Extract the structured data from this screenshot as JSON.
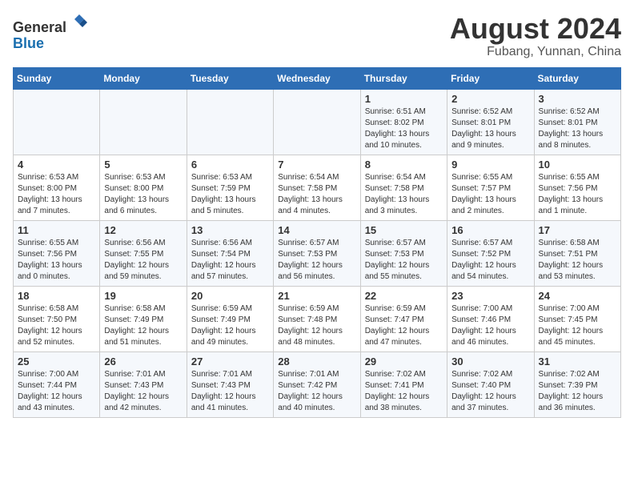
{
  "header": {
    "logo_general": "General",
    "logo_blue": "Blue",
    "month_title": "August 2024",
    "location": "Fubang, Yunnan, China"
  },
  "weekdays": [
    "Sunday",
    "Monday",
    "Tuesday",
    "Wednesday",
    "Thursday",
    "Friday",
    "Saturday"
  ],
  "weeks": [
    [
      {
        "day": "",
        "sunrise": "",
        "sunset": "",
        "daylight": ""
      },
      {
        "day": "",
        "sunrise": "",
        "sunset": "",
        "daylight": ""
      },
      {
        "day": "",
        "sunrise": "",
        "sunset": "",
        "daylight": ""
      },
      {
        "day": "",
        "sunrise": "",
        "sunset": "",
        "daylight": ""
      },
      {
        "day": "1",
        "sunrise": "Sunrise: 6:51 AM",
        "sunset": "Sunset: 8:02 PM",
        "daylight": "Daylight: 13 hours and 10 minutes."
      },
      {
        "day": "2",
        "sunrise": "Sunrise: 6:52 AM",
        "sunset": "Sunset: 8:01 PM",
        "daylight": "Daylight: 13 hours and 9 minutes."
      },
      {
        "day": "3",
        "sunrise": "Sunrise: 6:52 AM",
        "sunset": "Sunset: 8:01 PM",
        "daylight": "Daylight: 13 hours and 8 minutes."
      }
    ],
    [
      {
        "day": "4",
        "sunrise": "Sunrise: 6:53 AM",
        "sunset": "Sunset: 8:00 PM",
        "daylight": "Daylight: 13 hours and 7 minutes."
      },
      {
        "day": "5",
        "sunrise": "Sunrise: 6:53 AM",
        "sunset": "Sunset: 8:00 PM",
        "daylight": "Daylight: 13 hours and 6 minutes."
      },
      {
        "day": "6",
        "sunrise": "Sunrise: 6:53 AM",
        "sunset": "Sunset: 7:59 PM",
        "daylight": "Daylight: 13 hours and 5 minutes."
      },
      {
        "day": "7",
        "sunrise": "Sunrise: 6:54 AM",
        "sunset": "Sunset: 7:58 PM",
        "daylight": "Daylight: 13 hours and 4 minutes."
      },
      {
        "day": "8",
        "sunrise": "Sunrise: 6:54 AM",
        "sunset": "Sunset: 7:58 PM",
        "daylight": "Daylight: 13 hours and 3 minutes."
      },
      {
        "day": "9",
        "sunrise": "Sunrise: 6:55 AM",
        "sunset": "Sunset: 7:57 PM",
        "daylight": "Daylight: 13 hours and 2 minutes."
      },
      {
        "day": "10",
        "sunrise": "Sunrise: 6:55 AM",
        "sunset": "Sunset: 7:56 PM",
        "daylight": "Daylight: 13 hours and 1 minute."
      }
    ],
    [
      {
        "day": "11",
        "sunrise": "Sunrise: 6:55 AM",
        "sunset": "Sunset: 7:56 PM",
        "daylight": "Daylight: 13 hours and 0 minutes."
      },
      {
        "day": "12",
        "sunrise": "Sunrise: 6:56 AM",
        "sunset": "Sunset: 7:55 PM",
        "daylight": "Daylight: 12 hours and 59 minutes."
      },
      {
        "day": "13",
        "sunrise": "Sunrise: 6:56 AM",
        "sunset": "Sunset: 7:54 PM",
        "daylight": "Daylight: 12 hours and 57 minutes."
      },
      {
        "day": "14",
        "sunrise": "Sunrise: 6:57 AM",
        "sunset": "Sunset: 7:53 PM",
        "daylight": "Daylight: 12 hours and 56 minutes."
      },
      {
        "day": "15",
        "sunrise": "Sunrise: 6:57 AM",
        "sunset": "Sunset: 7:53 PM",
        "daylight": "Daylight: 12 hours and 55 minutes."
      },
      {
        "day": "16",
        "sunrise": "Sunrise: 6:57 AM",
        "sunset": "Sunset: 7:52 PM",
        "daylight": "Daylight: 12 hours and 54 minutes."
      },
      {
        "day": "17",
        "sunrise": "Sunrise: 6:58 AM",
        "sunset": "Sunset: 7:51 PM",
        "daylight": "Daylight: 12 hours and 53 minutes."
      }
    ],
    [
      {
        "day": "18",
        "sunrise": "Sunrise: 6:58 AM",
        "sunset": "Sunset: 7:50 PM",
        "daylight": "Daylight: 12 hours and 52 minutes."
      },
      {
        "day": "19",
        "sunrise": "Sunrise: 6:58 AM",
        "sunset": "Sunset: 7:49 PM",
        "daylight": "Daylight: 12 hours and 51 minutes."
      },
      {
        "day": "20",
        "sunrise": "Sunrise: 6:59 AM",
        "sunset": "Sunset: 7:49 PM",
        "daylight": "Daylight: 12 hours and 49 minutes."
      },
      {
        "day": "21",
        "sunrise": "Sunrise: 6:59 AM",
        "sunset": "Sunset: 7:48 PM",
        "daylight": "Daylight: 12 hours and 48 minutes."
      },
      {
        "day": "22",
        "sunrise": "Sunrise: 6:59 AM",
        "sunset": "Sunset: 7:47 PM",
        "daylight": "Daylight: 12 hours and 47 minutes."
      },
      {
        "day": "23",
        "sunrise": "Sunrise: 7:00 AM",
        "sunset": "Sunset: 7:46 PM",
        "daylight": "Daylight: 12 hours and 46 minutes."
      },
      {
        "day": "24",
        "sunrise": "Sunrise: 7:00 AM",
        "sunset": "Sunset: 7:45 PM",
        "daylight": "Daylight: 12 hours and 45 minutes."
      }
    ],
    [
      {
        "day": "25",
        "sunrise": "Sunrise: 7:00 AM",
        "sunset": "Sunset: 7:44 PM",
        "daylight": "Daylight: 12 hours and 43 minutes."
      },
      {
        "day": "26",
        "sunrise": "Sunrise: 7:01 AM",
        "sunset": "Sunset: 7:43 PM",
        "daylight": "Daylight: 12 hours and 42 minutes."
      },
      {
        "day": "27",
        "sunrise": "Sunrise: 7:01 AM",
        "sunset": "Sunset: 7:43 PM",
        "daylight": "Daylight: 12 hours and 41 minutes."
      },
      {
        "day": "28",
        "sunrise": "Sunrise: 7:01 AM",
        "sunset": "Sunset: 7:42 PM",
        "daylight": "Daylight: 12 hours and 40 minutes."
      },
      {
        "day": "29",
        "sunrise": "Sunrise: 7:02 AM",
        "sunset": "Sunset: 7:41 PM",
        "daylight": "Daylight: 12 hours and 38 minutes."
      },
      {
        "day": "30",
        "sunrise": "Sunrise: 7:02 AM",
        "sunset": "Sunset: 7:40 PM",
        "daylight": "Daylight: 12 hours and 37 minutes."
      },
      {
        "day": "31",
        "sunrise": "Sunrise: 7:02 AM",
        "sunset": "Sunset: 7:39 PM",
        "daylight": "Daylight: 12 hours and 36 minutes."
      }
    ]
  ]
}
